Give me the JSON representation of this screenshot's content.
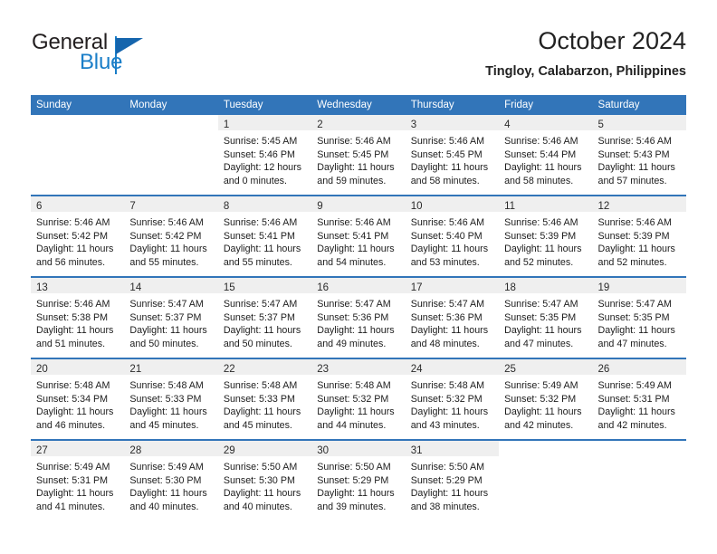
{
  "brand": {
    "word_general": "General",
    "word_blue": "Blue",
    "logo_icon": "general-blue-triangle-logo"
  },
  "header": {
    "title": "October 2024",
    "subtitle": "Tingloy, Calabarzon, Philippines"
  },
  "theme": {
    "header_blue": "#3275b9",
    "daynum_band": "#efefef",
    "brand_blue": "#1a7ec8",
    "brand_dark": "#231f20",
    "text": "#1c1c1c",
    "page_background": "#ffffff"
  },
  "calendar": {
    "weekday_headers": [
      "Sunday",
      "Monday",
      "Tuesday",
      "Wednesday",
      "Thursday",
      "Friday",
      "Saturday"
    ],
    "labels": {
      "sunrise": "Sunrise:",
      "sunset": "Sunset:",
      "daylight": "Daylight:"
    },
    "weeks": [
      [
        {
          "day": "",
          "lines": []
        },
        {
          "day": "",
          "lines": []
        },
        {
          "day": "1",
          "lines": [
            "Sunrise: 5:45 AM",
            "Sunset: 5:46 PM",
            "Daylight: 12 hours",
            "and 0 minutes."
          ]
        },
        {
          "day": "2",
          "lines": [
            "Sunrise: 5:46 AM",
            "Sunset: 5:45 PM",
            "Daylight: 11 hours",
            "and 59 minutes."
          ]
        },
        {
          "day": "3",
          "lines": [
            "Sunrise: 5:46 AM",
            "Sunset: 5:45 PM",
            "Daylight: 11 hours",
            "and 58 minutes."
          ]
        },
        {
          "day": "4",
          "lines": [
            "Sunrise: 5:46 AM",
            "Sunset: 5:44 PM",
            "Daylight: 11 hours",
            "and 58 minutes."
          ]
        },
        {
          "day": "5",
          "lines": [
            "Sunrise: 5:46 AM",
            "Sunset: 5:43 PM",
            "Daylight: 11 hours",
            "and 57 minutes."
          ]
        }
      ],
      [
        {
          "day": "6",
          "lines": [
            "Sunrise: 5:46 AM",
            "Sunset: 5:42 PM",
            "Daylight: 11 hours",
            "and 56 minutes."
          ]
        },
        {
          "day": "7",
          "lines": [
            "Sunrise: 5:46 AM",
            "Sunset: 5:42 PM",
            "Daylight: 11 hours",
            "and 55 minutes."
          ]
        },
        {
          "day": "8",
          "lines": [
            "Sunrise: 5:46 AM",
            "Sunset: 5:41 PM",
            "Daylight: 11 hours",
            "and 55 minutes."
          ]
        },
        {
          "day": "9",
          "lines": [
            "Sunrise: 5:46 AM",
            "Sunset: 5:41 PM",
            "Daylight: 11 hours",
            "and 54 minutes."
          ]
        },
        {
          "day": "10",
          "lines": [
            "Sunrise: 5:46 AM",
            "Sunset: 5:40 PM",
            "Daylight: 11 hours",
            "and 53 minutes."
          ]
        },
        {
          "day": "11",
          "lines": [
            "Sunrise: 5:46 AM",
            "Sunset: 5:39 PM",
            "Daylight: 11 hours",
            "and 52 minutes."
          ]
        },
        {
          "day": "12",
          "lines": [
            "Sunrise: 5:46 AM",
            "Sunset: 5:39 PM",
            "Daylight: 11 hours",
            "and 52 minutes."
          ]
        }
      ],
      [
        {
          "day": "13",
          "lines": [
            "Sunrise: 5:46 AM",
            "Sunset: 5:38 PM",
            "Daylight: 11 hours",
            "and 51 minutes."
          ]
        },
        {
          "day": "14",
          "lines": [
            "Sunrise: 5:47 AM",
            "Sunset: 5:37 PM",
            "Daylight: 11 hours",
            "and 50 minutes."
          ]
        },
        {
          "day": "15",
          "lines": [
            "Sunrise: 5:47 AM",
            "Sunset: 5:37 PM",
            "Daylight: 11 hours",
            "and 50 minutes."
          ]
        },
        {
          "day": "16",
          "lines": [
            "Sunrise: 5:47 AM",
            "Sunset: 5:36 PM",
            "Daylight: 11 hours",
            "and 49 minutes."
          ]
        },
        {
          "day": "17",
          "lines": [
            "Sunrise: 5:47 AM",
            "Sunset: 5:36 PM",
            "Daylight: 11 hours",
            "and 48 minutes."
          ]
        },
        {
          "day": "18",
          "lines": [
            "Sunrise: 5:47 AM",
            "Sunset: 5:35 PM",
            "Daylight: 11 hours",
            "and 47 minutes."
          ]
        },
        {
          "day": "19",
          "lines": [
            "Sunrise: 5:47 AM",
            "Sunset: 5:35 PM",
            "Daylight: 11 hours",
            "and 47 minutes."
          ]
        }
      ],
      [
        {
          "day": "20",
          "lines": [
            "Sunrise: 5:48 AM",
            "Sunset: 5:34 PM",
            "Daylight: 11 hours",
            "and 46 minutes."
          ]
        },
        {
          "day": "21",
          "lines": [
            "Sunrise: 5:48 AM",
            "Sunset: 5:33 PM",
            "Daylight: 11 hours",
            "and 45 minutes."
          ]
        },
        {
          "day": "22",
          "lines": [
            "Sunrise: 5:48 AM",
            "Sunset: 5:33 PM",
            "Daylight: 11 hours",
            "and 45 minutes."
          ]
        },
        {
          "day": "23",
          "lines": [
            "Sunrise: 5:48 AM",
            "Sunset: 5:32 PM",
            "Daylight: 11 hours",
            "and 44 minutes."
          ]
        },
        {
          "day": "24",
          "lines": [
            "Sunrise: 5:48 AM",
            "Sunset: 5:32 PM",
            "Daylight: 11 hours",
            "and 43 minutes."
          ]
        },
        {
          "day": "25",
          "lines": [
            "Sunrise: 5:49 AM",
            "Sunset: 5:32 PM",
            "Daylight: 11 hours",
            "and 42 minutes."
          ]
        },
        {
          "day": "26",
          "lines": [
            "Sunrise: 5:49 AM",
            "Sunset: 5:31 PM",
            "Daylight: 11 hours",
            "and 42 minutes."
          ]
        }
      ],
      [
        {
          "day": "27",
          "lines": [
            "Sunrise: 5:49 AM",
            "Sunset: 5:31 PM",
            "Daylight: 11 hours",
            "and 41 minutes."
          ]
        },
        {
          "day": "28",
          "lines": [
            "Sunrise: 5:49 AM",
            "Sunset: 5:30 PM",
            "Daylight: 11 hours",
            "and 40 minutes."
          ]
        },
        {
          "day": "29",
          "lines": [
            "Sunrise: 5:50 AM",
            "Sunset: 5:30 PM",
            "Daylight: 11 hours",
            "and 40 minutes."
          ]
        },
        {
          "day": "30",
          "lines": [
            "Sunrise: 5:50 AM",
            "Sunset: 5:29 PM",
            "Daylight: 11 hours",
            "and 39 minutes."
          ]
        },
        {
          "day": "31",
          "lines": [
            "Sunrise: 5:50 AM",
            "Sunset: 5:29 PM",
            "Daylight: 11 hours",
            "and 38 minutes."
          ]
        },
        {
          "day": "",
          "lines": []
        },
        {
          "day": "",
          "lines": []
        }
      ]
    ]
  }
}
